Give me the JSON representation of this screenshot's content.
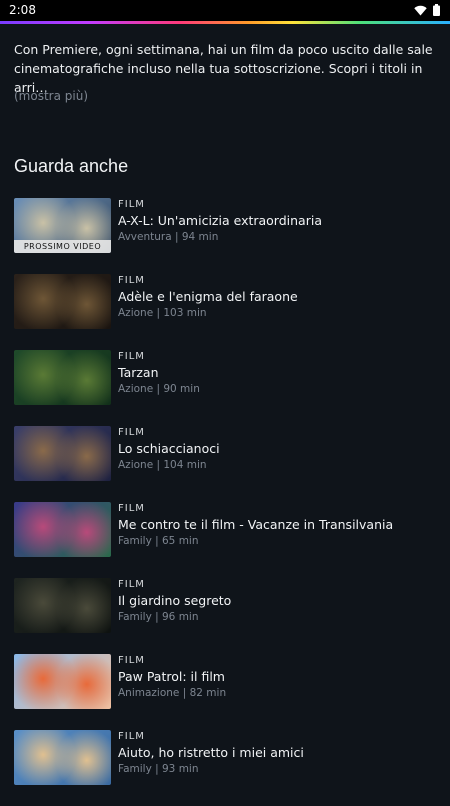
{
  "status": {
    "time": "2:08"
  },
  "description": {
    "text": "Con Premiere, ogni settimana, hai un film da poco uscito dalle sale cinematografiche incluso nella tua sottoscrizione. Scopri i titoli in arri…",
    "more_label": "(mostra più)"
  },
  "section": {
    "title": "Guarda anche"
  },
  "items": [
    {
      "kind": "FILM",
      "title": "A-X-L: Un'amicizia extraordinaria",
      "sub": "Avventura | 94 min",
      "badge": "PROSSIMO VIDEO",
      "colors": [
        "#6a8fb8",
        "#c9c1a6",
        "#3b4f66"
      ]
    },
    {
      "kind": "FILM",
      "title": "Adèle e l'enigma del faraone",
      "sub": "Azione | 103 min",
      "colors": [
        "#2a211a",
        "#6e5636",
        "#1a1410"
      ]
    },
    {
      "kind": "FILM",
      "title": "Tarzan",
      "sub": "Azione | 90 min",
      "colors": [
        "#1f4a2a",
        "#5a7a35",
        "#12301a"
      ]
    },
    {
      "kind": "FILM",
      "title": "Lo schiaccianoci",
      "sub": "Azione | 104 min",
      "colors": [
        "#3a3f6a",
        "#8a6a4a",
        "#1e2140"
      ]
    },
    {
      "kind": "FILM",
      "title": "Me contro te il film - Vacanze in Transilvania",
      "sub": "Family | 65 min",
      "colors": [
        "#3a3a8a",
        "#b84a7a",
        "#2a6a4a"
      ]
    },
    {
      "kind": "FILM",
      "title": "Il giardino segreto",
      "sub": "Family | 96 min",
      "colors": [
        "#1e2420",
        "#4a4a3a",
        "#0e1210"
      ]
    },
    {
      "kind": "FILM",
      "title": "Paw Patrol: il film",
      "sub": "Animazione | 82 min",
      "colors": [
        "#8ab8e8",
        "#e86a3a",
        "#f0c0a0"
      ]
    },
    {
      "kind": "FILM",
      "title": "Aiuto, ho ristretto i miei amici",
      "sub": "Family | 93 min",
      "colors": [
        "#5a90c8",
        "#e0c090",
        "#3a6aa0"
      ]
    }
  ]
}
